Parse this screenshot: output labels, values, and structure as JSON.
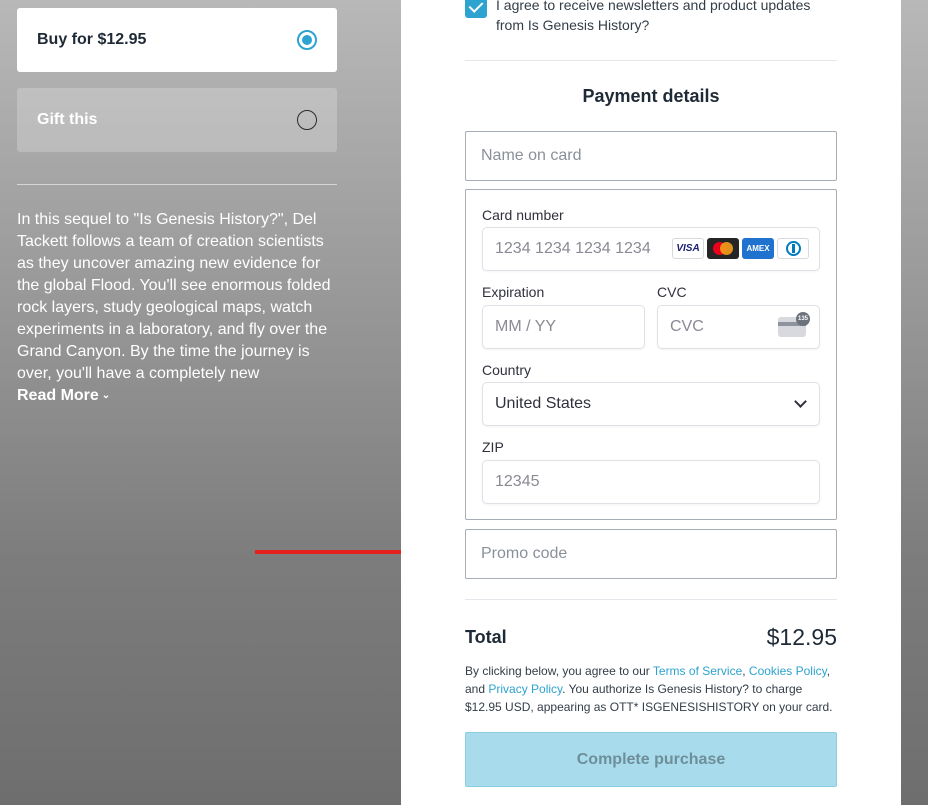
{
  "purchase_options": {
    "buy_label": "Buy for $12.95",
    "gift_label": "Gift this",
    "selected": "buy"
  },
  "description": {
    "text": "In this sequel to \"Is Genesis History?\", Del Tackett follows a team of creation scientists as they uncover amazing new evidence for the global Flood. You'll see enormous folded rock layers, study geological maps, watch experiments in a laboratory, and fly over the Grand Canyon. By the time the journey is over, you'll have a completely new",
    "read_more": "Read More"
  },
  "consent": {
    "checked": true,
    "text": "I agree to receive newsletters and product updates from Is Genesis History?"
  },
  "payment": {
    "title": "Payment details",
    "name_placeholder": "Name on card",
    "card_number_label": "Card number",
    "card_number_placeholder": "1234 1234 1234 1234",
    "card_brands": [
      "VISA",
      "mastercard",
      "AMEX",
      "diners"
    ],
    "expiration_label": "Expiration",
    "expiration_placeholder": "MM / YY",
    "cvc_label": "CVC",
    "cvc_placeholder": "CVC",
    "cvc_icon_number": "135",
    "country_label": "Country",
    "country_value": "United States",
    "zip_label": "ZIP",
    "zip_placeholder": "12345",
    "promo_placeholder": "Promo code"
  },
  "summary": {
    "total_label": "Total",
    "total_value": "$12.95"
  },
  "legal": {
    "prefix": "By clicking below, you agree to our ",
    "terms_link": "Terms of Service",
    "comma1": ", ",
    "cookies_link": "Cookies Policy",
    "and": ", and ",
    "privacy_link": "Privacy Policy",
    "suffix": ". You authorize Is Genesis History? to charge $12.95 USD, appearing as OTT* ISGENESISHISTORY on your card."
  },
  "cta": {
    "label": "Complete purchase"
  },
  "colors": {
    "accent": "#2da3cf",
    "cta_disabled": "#a8dcec",
    "annotation_arrow": "#e3211d"
  }
}
